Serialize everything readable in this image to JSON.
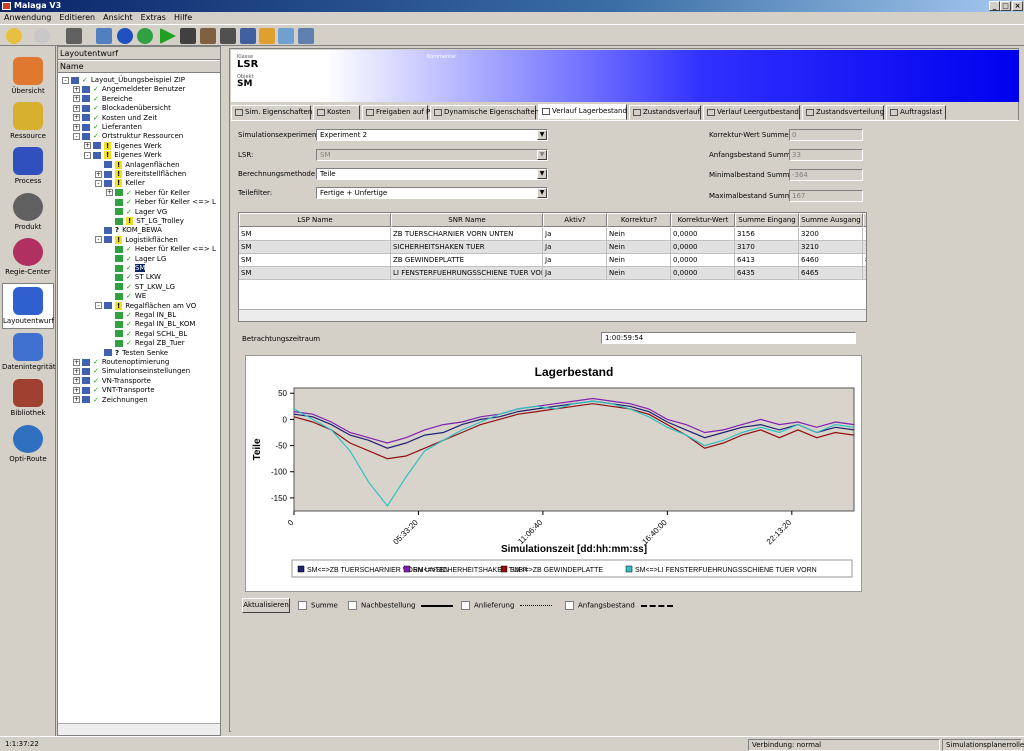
{
  "window": {
    "title": "Malaga V3"
  },
  "menu": [
    "Anwendung",
    "Editieren",
    "Ansicht",
    "Extras",
    "Hilfe"
  ],
  "leftbar": [
    {
      "label": "Übersicht",
      "color": "#e07830"
    },
    {
      "label": "Ressource",
      "color": "#d8b030"
    },
    {
      "label": "Process",
      "color": "#3050c0"
    },
    {
      "label": "Produkt",
      "color": "#606060"
    },
    {
      "label": "Regie-Center",
      "color": "#b03060"
    },
    {
      "label": "Layoutentwurf",
      "color": "#3060d0"
    },
    {
      "label": "Datenintegrität",
      "color": "#4070d0"
    },
    {
      "label": "Bibliothek",
      "color": "#a04030"
    },
    {
      "label": "Opti-Route",
      "color": "#3070c0"
    }
  ],
  "tree": {
    "title": "Layoutentwurf",
    "column": "Name",
    "items": [
      {
        "label": "Layout_Übungsbeispiel ZIP",
        "level": 0,
        "exp": "-",
        "icon": "chk"
      },
      {
        "label": "Angemeldeter Benutzer",
        "level": 1,
        "exp": "+",
        "icon": "chk"
      },
      {
        "label": "Bereiche",
        "level": 1,
        "exp": "+",
        "icon": "chk"
      },
      {
        "label": "Blockadenübersicht",
        "level": 1,
        "exp": "+",
        "icon": "chk"
      },
      {
        "label": "Kosten und Zeit",
        "level": 1,
        "exp": "+",
        "icon": "chk"
      },
      {
        "label": "Lieferanten",
        "level": 1,
        "exp": "+",
        "icon": "chk"
      },
      {
        "label": "Ortstruktur Ressourcen",
        "level": 1,
        "exp": "-",
        "icon": "chk"
      },
      {
        "label": "Eigenes Werk",
        "level": 2,
        "exp": "+",
        "icon": "warn"
      },
      {
        "label": "Eigenes Werk",
        "level": 2,
        "exp": "-",
        "icon": "warn"
      },
      {
        "label": "Anlagenflächen",
        "level": 3,
        "exp": "",
        "icon": "warn"
      },
      {
        "label": "Bereitstellflächen",
        "level": 3,
        "exp": "+",
        "icon": "warn"
      },
      {
        "label": "Keller",
        "level": 3,
        "exp": "-",
        "icon": "warn"
      },
      {
        "label": "Heber für Keller",
        "level": 4,
        "exp": "+",
        "icon": "chk"
      },
      {
        "label": "Heber für Keller <=> L",
        "level": 4,
        "exp": "",
        "icon": "chk"
      },
      {
        "label": "Lager VG",
        "level": 4,
        "exp": "",
        "icon": "chk"
      },
      {
        "label": "ST_LG_Trolley",
        "level": 4,
        "exp": "",
        "icon": "warn"
      },
      {
        "label": "KOM_BEWA",
        "level": 3,
        "exp": "",
        "icon": "q"
      },
      {
        "label": "Logistikflächen",
        "level": 3,
        "exp": "-",
        "icon": "warn"
      },
      {
        "label": "Heber für Keller <=> L",
        "level": 4,
        "exp": "",
        "icon": "chk"
      },
      {
        "label": "Lager LG",
        "level": 4,
        "exp": "",
        "icon": "chk"
      },
      {
        "label": "SM",
        "level": 4,
        "exp": "",
        "icon": "chk",
        "selected": true
      },
      {
        "label": "ST LKW",
        "level": 4,
        "exp": "",
        "icon": "chk"
      },
      {
        "label": "ST_LKW_LG",
        "level": 4,
        "exp": "",
        "icon": "chk"
      },
      {
        "label": "WE",
        "level": 4,
        "exp": "",
        "icon": "chk"
      },
      {
        "label": "Regalflächen am VO",
        "level": 3,
        "exp": "-",
        "icon": "warn"
      },
      {
        "label": "Regal IN_BL",
        "level": 4,
        "exp": "",
        "icon": "chk"
      },
      {
        "label": "Regal IN_BL_KOM",
        "level": 4,
        "exp": "",
        "icon": "chk"
      },
      {
        "label": "Regal SCHL_BL",
        "level": 4,
        "exp": "",
        "icon": "chk"
      },
      {
        "label": "Regal ZB_Tuer",
        "level": 4,
        "exp": "",
        "icon": "chk"
      },
      {
        "label": "Testen Senke",
        "level": 3,
        "exp": "",
        "icon": "q"
      },
      {
        "label": "Routenoptimierung",
        "level": 1,
        "exp": "+",
        "icon": "chk"
      },
      {
        "label": "Simulationseinstellungen",
        "level": 1,
        "exp": "+",
        "icon": "chk"
      },
      {
        "label": "VN-Transporte",
        "level": 1,
        "exp": "+",
        "icon": "chk"
      },
      {
        "label": "VNT-Transporte",
        "level": 1,
        "exp": "+",
        "icon": "chk"
      },
      {
        "label": "Zeichnungen",
        "level": 1,
        "exp": "+",
        "icon": "chk"
      }
    ]
  },
  "header": {
    "klasse_label": "Klasse",
    "klasse": "LSR",
    "objekt_label": "Objekt",
    "objekt": "SM",
    "kommentar_label": "Kommentar"
  },
  "tabs": [
    {
      "label": "Sim. Eigenschaften",
      "x": 0,
      "w": 80
    },
    {
      "label": "Kosten",
      "x": 82,
      "w": 47
    },
    {
      "label": "Freigaben auf PK",
      "x": 131,
      "w": 66
    },
    {
      "label": "Dynamische Eigenschaften",
      "x": 199,
      "w": 106
    },
    {
      "label": "Verlauf Lagerbestand",
      "x": 307,
      "w": 89,
      "active": true
    },
    {
      "label": "Zustandsverlauf",
      "x": 398,
      "w": 72
    },
    {
      "label": "Verlauf Leergutbestand",
      "x": 472,
      "w": 97
    },
    {
      "label": "Zustandsverteilung",
      "x": 571,
      "w": 82
    },
    {
      "label": "Auftragslast",
      "x": 655,
      "w": 60
    }
  ],
  "form": {
    "sim_label": "Simulationsexperiment:",
    "sim_value": "Experiment 2",
    "lsr_label": "LSR:",
    "lsr_value": "SM",
    "berech_label": "Berechnungsmethode:",
    "berech_value": "Teile",
    "teile_label": "Teilefilter:",
    "teile_value": "Fertige + Unfertige",
    "korr_label": "Korrektur-Wert Summe",
    "korr_value": "0",
    "anf_label": "Anfangsbestand Summe",
    "anf_value": "33",
    "min_label": "Minimalbestand Summe",
    "min_value": "-364",
    "max_label": "Maximalbestand Summe",
    "max_value": "167"
  },
  "table": {
    "columns": [
      "LSP Name",
      "SNR Name",
      "Aktiv?",
      "Korrektur?",
      "Korrektur-Wert",
      "Summe Eingang",
      "Summe Ausgang",
      ""
    ],
    "rows": [
      [
        "SM",
        "ZB TUERSCHARNIER VORN UNTEN",
        "Ja",
        "Nein",
        "0,0000",
        "3156",
        "3200",
        "1"
      ],
      [
        "SM",
        "SICHERHEITSHAKEN TUER",
        "Ja",
        "Nein",
        "0,0000",
        "3170",
        "3210",
        "1"
      ],
      [
        "SM",
        "ZB GEWINDEPLATTE",
        "Ja",
        "Nein",
        "0,0000",
        "6413",
        "6460",
        "8"
      ],
      [
        "SM",
        "LI FENSTERFUEHRUNGSSCHIENE TUER VORN",
        "Ja",
        "Nein",
        "0,0000",
        "6435",
        "6465",
        "1"
      ]
    ]
  },
  "betrachtung": {
    "label": "Betrachtungszeitraum",
    "value": "1:00:59:54"
  },
  "chart_data": {
    "type": "line",
    "title": "Lagerbestand",
    "ylabel": "Teile",
    "xlabel": "Simulationszeit [dd:hh:mm:ss]",
    "ylim": [
      -175,
      60
    ],
    "yticks": [
      "50",
      "0",
      "-50",
      "-100",
      "-150"
    ],
    "ytick_values": [
      50,
      0,
      -50,
      -100,
      -150
    ],
    "xticks": [
      "0",
      "05:33:20",
      "11:06:40",
      "16:40:00",
      "22:13:20"
    ],
    "xtick_values": [
      0,
      20000,
      40000,
      60000,
      80000
    ],
    "xlim": [
      0,
      89994
    ],
    "grid": false,
    "series": [
      {
        "name": "SM<=>ZB TUERSCHARNIER VORN UNTEN",
        "color": "#202070",
        "x": [
          0,
          3000,
          6000,
          9000,
          12000,
          15000,
          18000,
          21000,
          24000,
          27000,
          30000,
          33000,
          36000,
          39000,
          42000,
          45000,
          48000,
          51000,
          54000,
          57000,
          60000,
          63000,
          66000,
          69000,
          72000,
          75000,
          78000,
          81000,
          84000,
          87000,
          89994
        ],
        "values": [
          10,
          5,
          -10,
          -30,
          -40,
          -55,
          -45,
          -30,
          -25,
          -10,
          0,
          5,
          15,
          20,
          25,
          30,
          35,
          30,
          25,
          15,
          -5,
          -20,
          -35,
          -25,
          -15,
          -10,
          -20,
          -10,
          -25,
          -15,
          -20
        ]
      },
      {
        "name": "SM<=>SICHERHEITSHAKEN TUER",
        "color": "#8020b0",
        "x": [
          0,
          3000,
          6000,
          9000,
          12000,
          15000,
          18000,
          21000,
          24000,
          27000,
          30000,
          33000,
          36000,
          39000,
          42000,
          45000,
          48000,
          51000,
          54000,
          57000,
          60000,
          63000,
          66000,
          69000,
          72000,
          75000,
          78000,
          81000,
          84000,
          87000,
          89994
        ],
        "values": [
          15,
          10,
          -5,
          -25,
          -35,
          -45,
          -35,
          -20,
          -10,
          -5,
          5,
          10,
          20,
          25,
          30,
          35,
          40,
          35,
          30,
          20,
          0,
          -10,
          -25,
          -20,
          -10,
          0,
          -10,
          -5,
          -15,
          -5,
          -10
        ]
      },
      {
        "name": "SM<=>ZB GEWINDEPLATTE",
        "color": "#901010",
        "x": [
          0,
          3000,
          6000,
          9000,
          12000,
          15000,
          18000,
          21000,
          24000,
          27000,
          30000,
          33000,
          36000,
          39000,
          42000,
          45000,
          48000,
          51000,
          54000,
          57000,
          60000,
          63000,
          66000,
          69000,
          72000,
          75000,
          78000,
          81000,
          84000,
          87000,
          89994
        ],
        "values": [
          5,
          -5,
          -20,
          -45,
          -60,
          -75,
          -70,
          -55,
          -40,
          -25,
          -10,
          0,
          10,
          15,
          20,
          25,
          30,
          25,
          20,
          10,
          -10,
          -30,
          -55,
          -45,
          -30,
          -20,
          -35,
          -20,
          -35,
          -25,
          -30
        ]
      },
      {
        "name": "SM<=>LI FENSTERFUEHRUNGSSCHIENE TUER VORN",
        "color": "#30c0c0",
        "x": [
          0,
          3000,
          6000,
          9000,
          12000,
          15000,
          18000,
          21000,
          24000,
          27000,
          30000,
          33000,
          36000,
          39000,
          42000,
          45000,
          48000,
          51000,
          54000,
          57000,
          60000,
          63000,
          66000,
          69000,
          72000,
          75000,
          78000,
          81000,
          84000,
          87000,
          89994
        ],
        "values": [
          20,
          0,
          -20,
          -60,
          -120,
          -165,
          -110,
          -60,
          -40,
          -20,
          -5,
          10,
          20,
          25,
          20,
          30,
          35,
          30,
          20,
          5,
          -15,
          -30,
          -50,
          -40,
          -25,
          -15,
          -25,
          -10,
          -25,
          -10,
          -15
        ]
      }
    ]
  },
  "bottom": {
    "refresh": "Aktualisieren",
    "summe": "Summe",
    "nachbestellung": "Nachbestellung",
    "anlieferung": "Anlieferung",
    "anfangsbestand": "Anfangsbestand"
  },
  "status": {
    "time": "1:1:37:22",
    "verbindung": "Verbindung: normal",
    "mode": "Simulationsplanerrolle"
  }
}
